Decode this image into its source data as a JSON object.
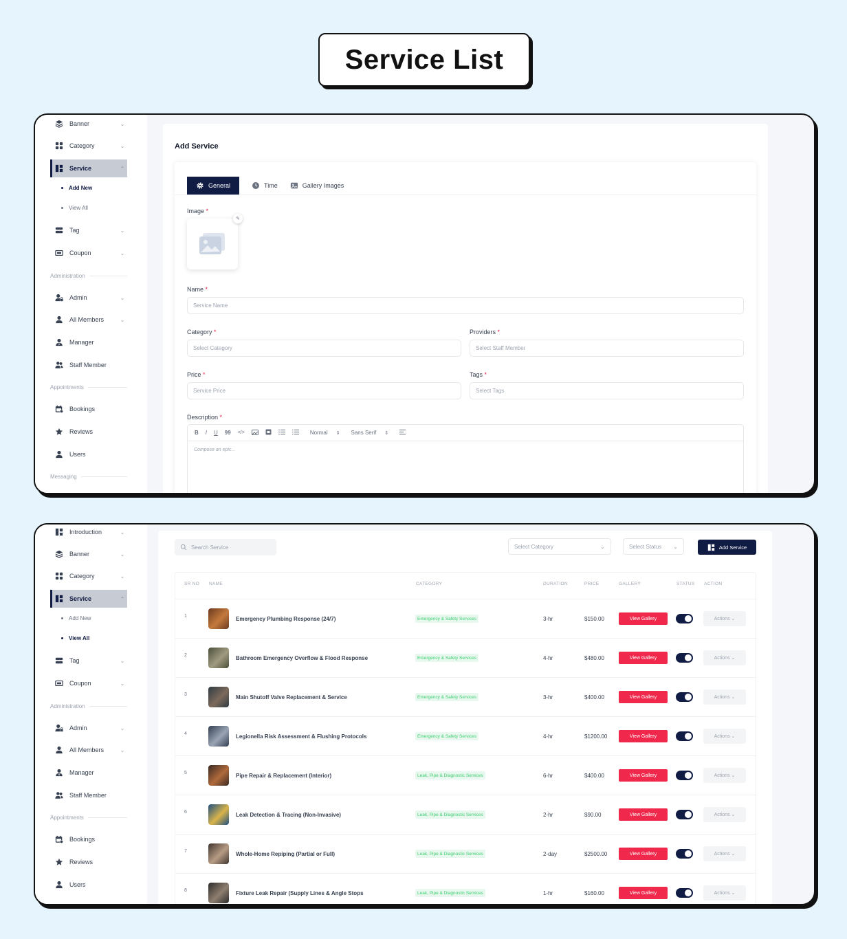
{
  "page_title": "Service List",
  "colors": {
    "navy": "#111c44",
    "danger": "#f0294c",
    "success": "#3ccf70"
  },
  "sidebar1": {
    "items": [
      {
        "label": "Banner",
        "icon": "layers-icon",
        "chevron": "⌄"
      },
      {
        "label": "Category",
        "icon": "grid-icon",
        "chevron": "⌄"
      },
      {
        "label": "Service",
        "icon": "layout-icon",
        "chevron": "⌃"
      },
      {
        "label": "Tag",
        "icon": "tag-icon",
        "chevron": "⌄"
      },
      {
        "label": "Coupon",
        "icon": "ticket-icon",
        "chevron": "⌄"
      },
      {
        "label": "Admin",
        "icon": "user-lock-icon",
        "chevron": "⌄"
      },
      {
        "label": "All Members",
        "icon": "user-icon",
        "chevron": "⌄"
      },
      {
        "label": "Manager",
        "icon": "user-tie-icon"
      },
      {
        "label": "Staff Member",
        "icon": "users-icon"
      },
      {
        "label": "Bookings",
        "icon": "calendar-icon"
      },
      {
        "label": "Reviews",
        "icon": "star-icon"
      },
      {
        "label": "Users",
        "icon": "user-icon"
      }
    ],
    "sub": [
      "Add New",
      "View All"
    ],
    "sections": [
      "Administration",
      "Appointments",
      "Messaging"
    ]
  },
  "sidebar2": {
    "items": [
      {
        "label": "Introduction",
        "icon": "layout-icon",
        "chevron": "⌄"
      },
      {
        "label": "Banner",
        "icon": "layers-icon",
        "chevron": "⌄"
      },
      {
        "label": "Category",
        "icon": "grid-icon",
        "chevron": "⌄"
      },
      {
        "label": "Service",
        "icon": "layout-icon",
        "chevron": "⌃"
      },
      {
        "label": "Tag",
        "icon": "tag-icon",
        "chevron": "⌄"
      },
      {
        "label": "Coupon",
        "icon": "ticket-icon",
        "chevron": "⌄"
      },
      {
        "label": "Admin",
        "icon": "user-lock-icon",
        "chevron": "⌄"
      },
      {
        "label": "All Members",
        "icon": "user-icon",
        "chevron": "⌄"
      },
      {
        "label": "Manager",
        "icon": "user-tie-icon"
      },
      {
        "label": "Staff Member",
        "icon": "users-icon"
      },
      {
        "label": "Bookings",
        "icon": "calendar-icon"
      },
      {
        "label": "Reviews",
        "icon": "star-icon"
      },
      {
        "label": "Users",
        "icon": "user-icon"
      }
    ],
    "sub": [
      "Add New",
      "View All"
    ],
    "sections": [
      "Administration",
      "Appointments"
    ]
  },
  "form": {
    "heading": "Add Service",
    "tabs": [
      "General",
      "Time",
      "Gallery Images"
    ],
    "image_label": "Image",
    "required_mark": "*",
    "name_label": "Name",
    "name_placeholder": "Service Name",
    "category_label": "Category",
    "category_placeholder": "Select Category",
    "providers_label": "Providers",
    "providers_placeholder": "Select Staff Member",
    "price_label": "Price",
    "price_placeholder": "Service Price",
    "tags_label": "Tags",
    "tags_placeholder": "Select Tags",
    "description_label": "Description",
    "toolbar": {
      "bold": "B",
      "italic": "I",
      "underline": "U",
      "quote": "99",
      "code": "</>",
      "size": "Normal",
      "font": "Sans Serif"
    },
    "editor_placeholder": "Compose an epic..."
  },
  "list": {
    "search_placeholder": "Search Service",
    "category_filter": "Select Category",
    "status_filter": "Select Status",
    "add_button": "Add Service",
    "columns": [
      "SR NO",
      "NAME",
      "CATEGORY",
      "DURATION",
      "PRICE",
      "GALLERY",
      "STATUS",
      "ACTION"
    ],
    "view_gallery_label": "View Gallery",
    "actions_label": "Actions ⌄",
    "rows": [
      {
        "sr": "1",
        "name": "Emergency Plumbing Response (24/7)",
        "category": "Emergency & Safety Services",
        "duration": "3-hr",
        "price": "$150.00",
        "status_on": true
      },
      {
        "sr": "2",
        "name": "Bathroom Emergency Overflow & Flood Response",
        "category": "Emergency & Safety Services",
        "duration": "4-hr",
        "price": "$480.00",
        "status_on": true
      },
      {
        "sr": "3",
        "name": "Main Shutoff Valve Replacement & Service",
        "category": "Emergency & Safety Services",
        "duration": "3-hr",
        "price": "$400.00",
        "status_on": true
      },
      {
        "sr": "4",
        "name": "Legionella Risk Assessment & Flushing Protocols",
        "category": "Emergency & Safety Services",
        "duration": "4-hr",
        "price": "$1200.00",
        "status_on": true
      },
      {
        "sr": "5",
        "name": "Pipe Repair & Replacement (Interior)",
        "category": "Leak, Pipe & Diagnostic Services",
        "duration": "6-hr",
        "price": "$400.00",
        "status_on": true
      },
      {
        "sr": "6",
        "name": "Leak Detection & Tracing (Non-Invasive)",
        "category": "Leak, Pipe & Diagnostic Services",
        "duration": "2-hr",
        "price": "$90.00",
        "status_on": true
      },
      {
        "sr": "7",
        "name": "Whole-Home Repiping (Partial or Full)",
        "category": "Leak, Pipe & Diagnostic Services",
        "duration": "2-day",
        "price": "$2500.00",
        "status_on": true
      },
      {
        "sr": "8",
        "name": "Fixture Leak Repair (Supply Lines & Angle Stops",
        "category": "Leak, Pipe & Diagnostic Services",
        "duration": "1-hr",
        "price": "$160.00",
        "status_on": true
      }
    ]
  }
}
